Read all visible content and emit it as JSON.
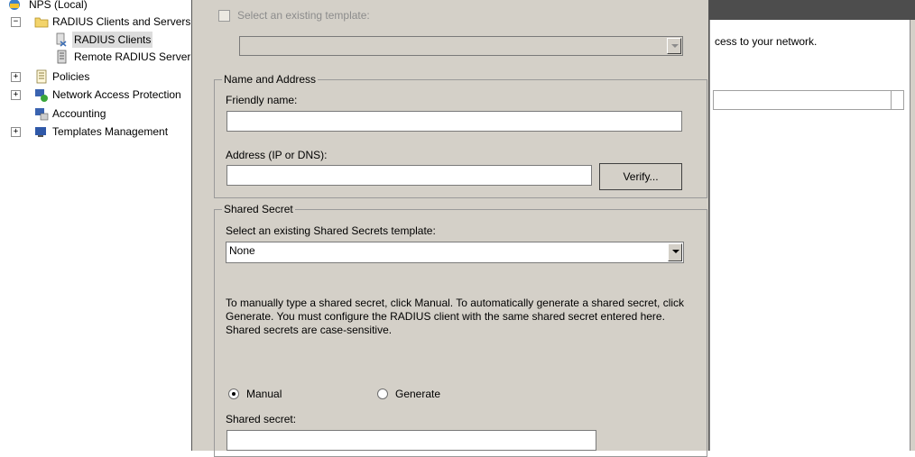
{
  "tree": {
    "items": [
      {
        "label": "NPS (Local)",
        "expander": "",
        "icon": "nps-server-icon"
      },
      {
        "label": "RADIUS Clients and Servers",
        "expander": "−",
        "icon": "folder-icon"
      },
      {
        "label": "RADIUS Clients",
        "expander": "",
        "icon": "radius-clients-icon",
        "selected": true
      },
      {
        "label": "Remote RADIUS Server Groups",
        "expander": "",
        "icon": "remote-server-icon"
      },
      {
        "label": "Policies",
        "expander": "+",
        "icon": "policies-icon"
      },
      {
        "label": "Network Access Protection",
        "expander": "+",
        "icon": "network-access-protection-icon"
      },
      {
        "label": "Accounting",
        "expander": "",
        "icon": "accounting-icon"
      },
      {
        "label": "Templates Management",
        "expander": "+",
        "icon": "templates-icon"
      }
    ]
  },
  "dialog": {
    "template_checkbox_label": "Select an existing template:",
    "template_combo_value": "",
    "name_address": {
      "group_title": "Name and Address",
      "friendly_name_label": "Friendly name:",
      "friendly_name_value": "",
      "address_label": "Address (IP or DNS):",
      "address_value": "",
      "verify_button": "Verify..."
    },
    "shared_secret": {
      "group_title": "Shared Secret",
      "template_label": "Select an existing Shared Secrets template:",
      "template_value": "None",
      "help_text": "To manually type a shared secret, click Manual. To automatically generate a shared secret, click Generate. You must configure the RADIUS client with the same shared secret entered here. Shared secrets are case-sensitive.",
      "manual_label": "Manual",
      "generate_label": "Generate",
      "selected_mode": "Manual",
      "shared_secret_label": "Shared secret:",
      "shared_secret_value": ""
    }
  },
  "right_pane": {
    "description_fragment": "cess to your network."
  },
  "colors": {
    "dialog_bg": "#d4d0c8",
    "header_bar": "#4d4d4d",
    "selection": "#dcdcdc"
  }
}
